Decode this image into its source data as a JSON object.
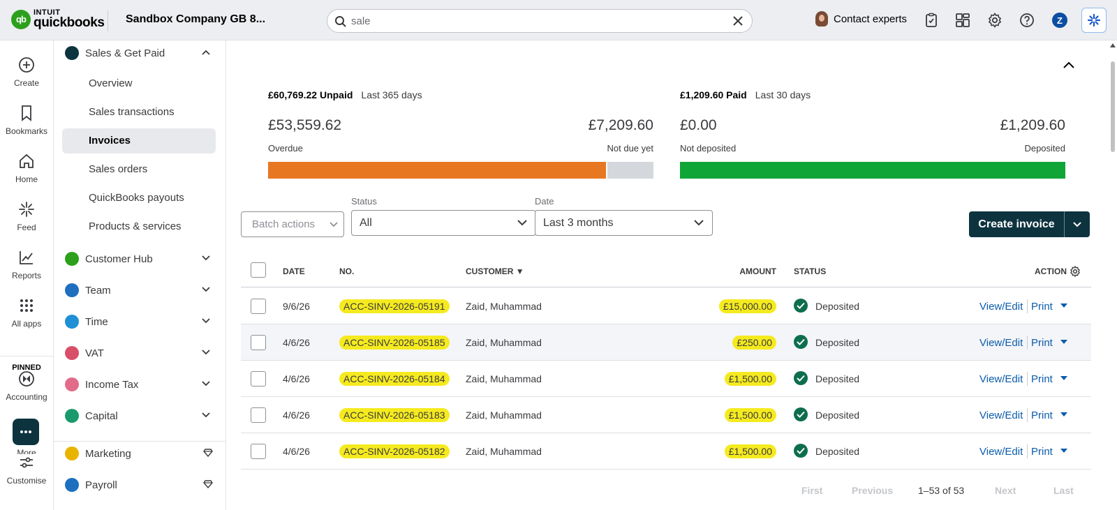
{
  "app": {
    "logo_top": "INTUIT",
    "logo_bottom": "quickbooks",
    "company": "Sandbox Company GB 8...",
    "search_value": "sale",
    "contact": "Contact experts",
    "user_initial": "Z"
  },
  "rail": {
    "items": [
      "Create",
      "Bookmarks",
      "Home",
      "Feed",
      "Reports",
      "All apps"
    ],
    "pinned": "PINNED",
    "accounting": "Accounting",
    "more": "More",
    "customise": "Customise"
  },
  "nav": {
    "sales_section": "Sales & Get Paid",
    "sub_items": [
      "Overview",
      "Sales transactions",
      "Invoices",
      "Sales orders",
      "QuickBooks payouts",
      "Products & services"
    ],
    "sections": [
      "Customer Hub",
      "Team",
      "Time",
      "VAT",
      "Income Tax",
      "Capital"
    ],
    "marketing": "Marketing",
    "payroll": "Payroll"
  },
  "summary": {
    "unpaid_title": "£60,769.22 Unpaid",
    "unpaid_period": "Last 365 days",
    "overdue_amount": "£53,559.62",
    "overdue_label": "Overdue",
    "notdue_amount": "£7,209.60",
    "notdue_label": "Not due yet",
    "overdue_fraction": 0.881,
    "paid_title": "£1,209.60 Paid",
    "paid_period": "Last 30 days",
    "notdeposited_amount": "£0.00",
    "notdeposited_label": "Not deposited",
    "deposited_amount": "£1,209.60",
    "deposited_label": "Deposited",
    "deposited_fraction": 1.0,
    "colors": {
      "overdue": "#e87722",
      "notdue": "#d4d7dc",
      "deposited": "#10a537"
    }
  },
  "filters": {
    "batch_actions": "Batch actions",
    "status_label": "Status",
    "status_value": "All",
    "date_label": "Date",
    "date_value": "Last 3 months",
    "create_invoice": "Create invoice"
  },
  "table": {
    "headers": {
      "date": "DATE",
      "no": "NO.",
      "customer": "CUSTOMER ▼",
      "amount": "AMOUNT",
      "status": "STATUS",
      "action": "ACTION"
    },
    "rows": [
      {
        "date": "9/6/26",
        "no": "ACC-SINV-2026-05191",
        "customer": "Zaid, Muhammad",
        "amount": "£15,000.00",
        "status": "Deposited"
      },
      {
        "date": "4/6/26",
        "no": "ACC-SINV-2026-05185",
        "customer": "Zaid, Muhammad",
        "amount": "£250.00",
        "status": "Deposited"
      },
      {
        "date": "4/6/26",
        "no": "ACC-SINV-2026-05184",
        "customer": "Zaid, Muhammad",
        "amount": "£1,500.00",
        "status": "Deposited"
      },
      {
        "date": "4/6/26",
        "no": "ACC-SINV-2026-05183",
        "customer": "Zaid, Muhammad",
        "amount": "£1,500.00",
        "status": "Deposited"
      },
      {
        "date": "4/6/26",
        "no": "ACC-SINV-2026-05182",
        "customer": "Zaid, Muhammad",
        "amount": "£1,500.00",
        "status": "Deposited"
      }
    ],
    "view_edit": "View/Edit",
    "print": "Print"
  },
  "pagination": {
    "first": "First",
    "previous": "Previous",
    "count": "1–53 of 53",
    "next": "Next",
    "last": "Last"
  }
}
